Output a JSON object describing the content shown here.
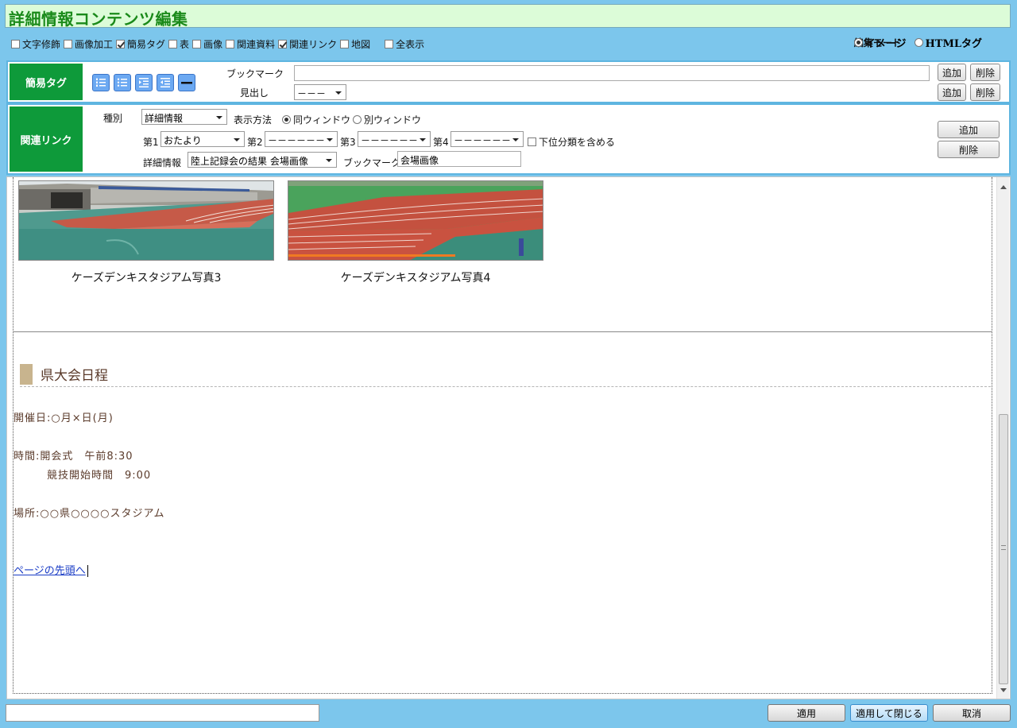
{
  "title": "詳細情報コンテンツ編集",
  "options": [
    {
      "label": "文字修飾",
      "checked": false
    },
    {
      "label": "画像加工",
      "checked": false
    },
    {
      "label": "簡易タグ",
      "checked": true
    },
    {
      "label": "表",
      "checked": false
    },
    {
      "label": "画像",
      "checked": false
    },
    {
      "label": "関連資料",
      "checked": false
    },
    {
      "label": "関連リンク",
      "checked": true
    },
    {
      "label": "地図",
      "checked": false
    },
    {
      "label": "全表示",
      "checked": false
    }
  ],
  "edit_mode": {
    "label": "編集モード",
    "image": "イメージ",
    "html": "HTMLタグ",
    "selected": "イメージ"
  },
  "simple_tag": {
    "header": "簡易タグ",
    "icons": [
      "ordered-list-icon",
      "unordered-list-icon",
      "indent-icon",
      "outdent-icon",
      "horizontal-rule-icon"
    ],
    "bookmark_label": "ブックマーク",
    "bookmark_value": "",
    "heading_label": "見出し",
    "heading_value": "－－－",
    "add": "追加",
    "delete": "削除"
  },
  "related_link": {
    "header": "関連リンク",
    "type_label": "種別",
    "type_value": "詳細情報",
    "display_label": "表示方法",
    "same_window": "同ウィンドウ",
    "other_window": "別ウィンドウ",
    "cat1_label": "第1",
    "cat1_value": "おたより",
    "cat2_label": "第2",
    "cat2_value": "－－－－－－",
    "cat3_label": "第3",
    "cat3_value": "－－－－－－",
    "cat4_label": "第4",
    "cat4_value": "－－－－－－",
    "include_sub": "下位分類を含める",
    "detail_label": "詳細情報",
    "detail_value": "陸上記録会の結果 会場画像",
    "bookmark_label": "ブックマーク",
    "bookmark_value": "会場画像",
    "add": "追加",
    "delete": "削除"
  },
  "content": {
    "caption3": "ケーズデンキスタジアム写真3",
    "caption4": "ケーズデンキスタジアム写真4",
    "heading": "県大会日程",
    "date": "開催日:○月×日(月)",
    "time1": "時間:開会式　午前8:30",
    "time2": "　　　競技開始時間　9:00",
    "place": "場所:○○県○○○○スタジアム",
    "top_link": "ページの先頭へ"
  },
  "footer": {
    "status": "",
    "apply": "適用",
    "apply_close": "適用して閉じる",
    "cancel": "取消"
  }
}
